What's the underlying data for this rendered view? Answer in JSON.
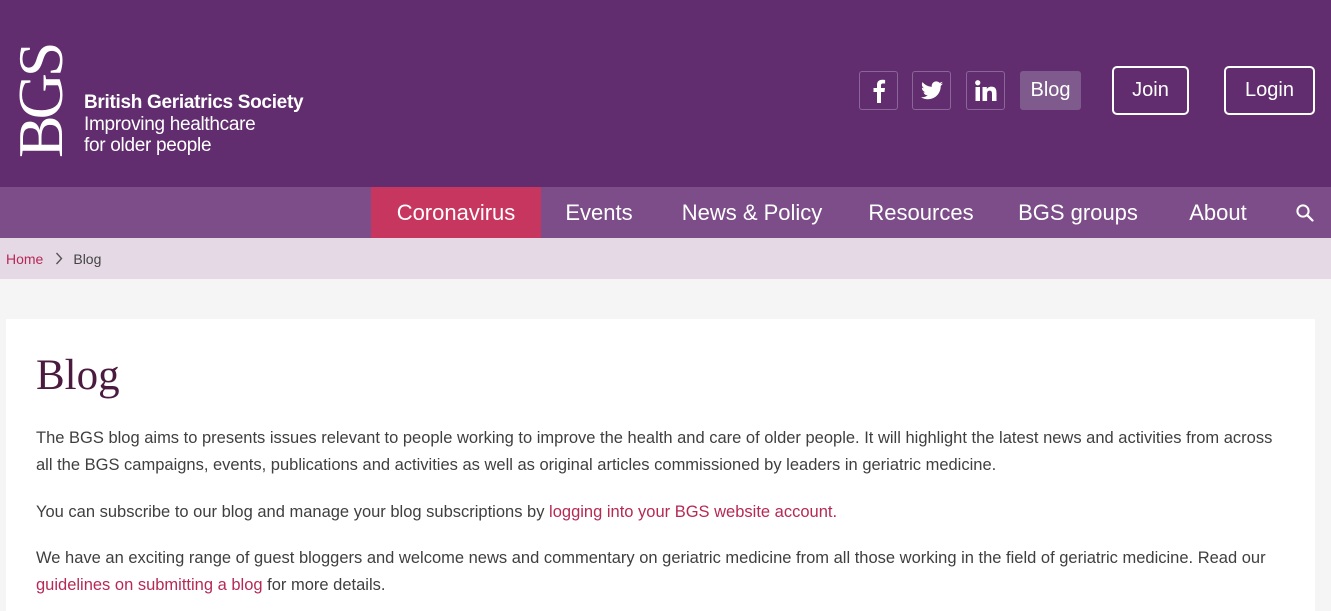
{
  "header": {
    "logo_mark": "BGS",
    "org_name": "British Geriatrics Society",
    "tagline_line1": "Improving healthcare",
    "tagline_line2": "for older people",
    "social": [
      "facebook-icon",
      "twitter-icon",
      "linkedin-icon"
    ],
    "blog_label": "Blog",
    "join_label": "Join",
    "login_label": "Login"
  },
  "nav": {
    "items": [
      {
        "label": "Coronavirus",
        "active": true
      },
      {
        "label": "Events"
      },
      {
        "label": "News & Policy"
      },
      {
        "label": "Resources"
      },
      {
        "label": "BGS groups"
      },
      {
        "label": "About"
      }
    ],
    "search_icon": "search-icon"
  },
  "breadcrumb": {
    "home": "Home",
    "current": "Blog"
  },
  "main": {
    "title": "Blog",
    "para1": "The BGS blog aims to presents issues relevant to people working to improve the health and care of older people. It will highlight the latest news and activities from across all the BGS campaigns, events, publications and activities as well as original articles commissioned by leaders in geriatric medicine.",
    "para2_text": "You can subscribe to our blog and manage your blog subscriptions by ",
    "para2_link": "logging into your BGS website account.",
    "para3_text": "We have an exciting range of guest bloggers and welcome news and commentary on geriatric medicine from all those working in the field of geriatric medicine. Read our ",
    "para3_link": "guidelines on submitting a blog",
    "para3_end": " for more details."
  },
  "colors": {
    "header_bg": "#612d6e",
    "nav_bg": "#7c4d89",
    "active_nav": "#c7365f",
    "breadcrumb_bg": "#e5d9e6",
    "link": "#b62955",
    "title": "#4b1a3f"
  }
}
